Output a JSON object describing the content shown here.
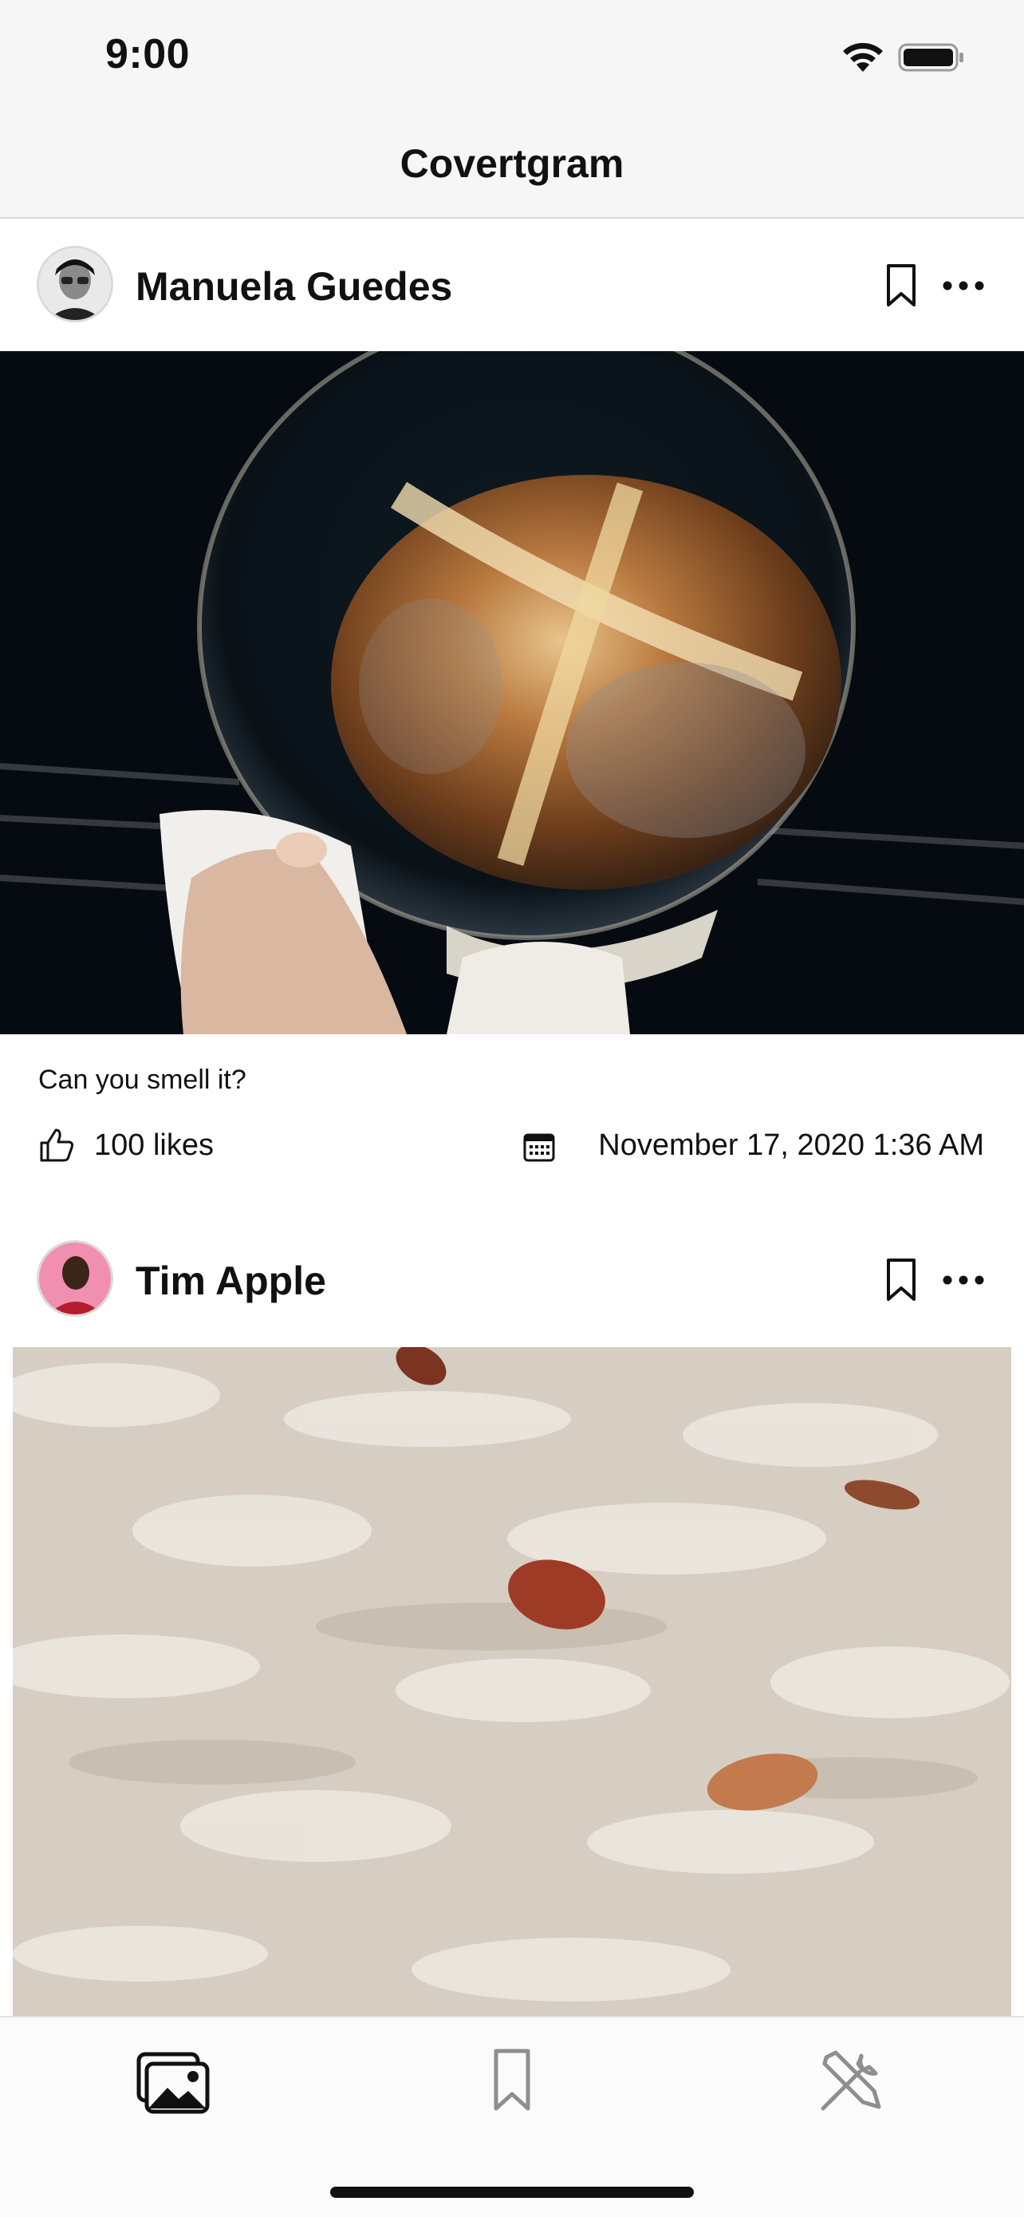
{
  "status": {
    "time": "9:00"
  },
  "nav": {
    "title": "Covertgram"
  },
  "posts": [
    {
      "author": "Manuela Guedes",
      "caption": "Can you smell it?",
      "likes": "100 likes",
      "date": "November 17, 2020 1:36 AM"
    },
    {
      "author": "Tim Apple"
    }
  ],
  "icons": {
    "wifi": "wifi-icon",
    "battery": "battery-icon",
    "bookmark": "bookmark-icon",
    "more": "ellipsis-icon",
    "like": "thumbs-up-icon",
    "calendar": "calendar-icon",
    "tab_feed": "photos-icon",
    "tab_saved": "bookmark-icon",
    "tab_tools": "tools-icon"
  },
  "colors": {
    "bar_bg": "#f6f6f6",
    "text": "#111111",
    "tab_inactive": "#8e8e8e"
  }
}
